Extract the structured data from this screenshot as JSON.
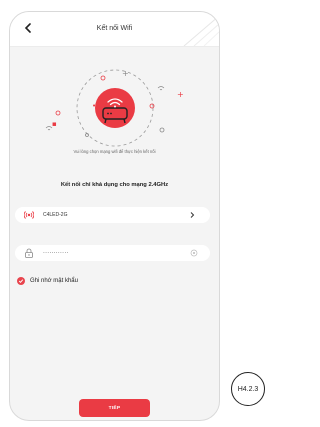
{
  "header": {
    "title": "Kết nối Wifi",
    "back_icon": "chevron-left-icon"
  },
  "illustration": {
    "icon": "router-wifi-icon",
    "accent_color": "#ea3b44"
  },
  "instruction_text": "Vui lòng chọn mạng wifi để thực hiện kết nối",
  "restriction_text": "Kết nối chỉ khả dụng cho mạng 2.4GHz",
  "wifi_field": {
    "icon": "wifi-signal-icon",
    "value": "C4LED-2G"
  },
  "password_field": {
    "icon": "lock-icon",
    "value": "············"
  },
  "remember": {
    "label": "Ghi nhớ mật khẩu",
    "checked": true
  },
  "next_button": {
    "label": "TIẾP"
  },
  "figure_ref": "H4.2.3"
}
